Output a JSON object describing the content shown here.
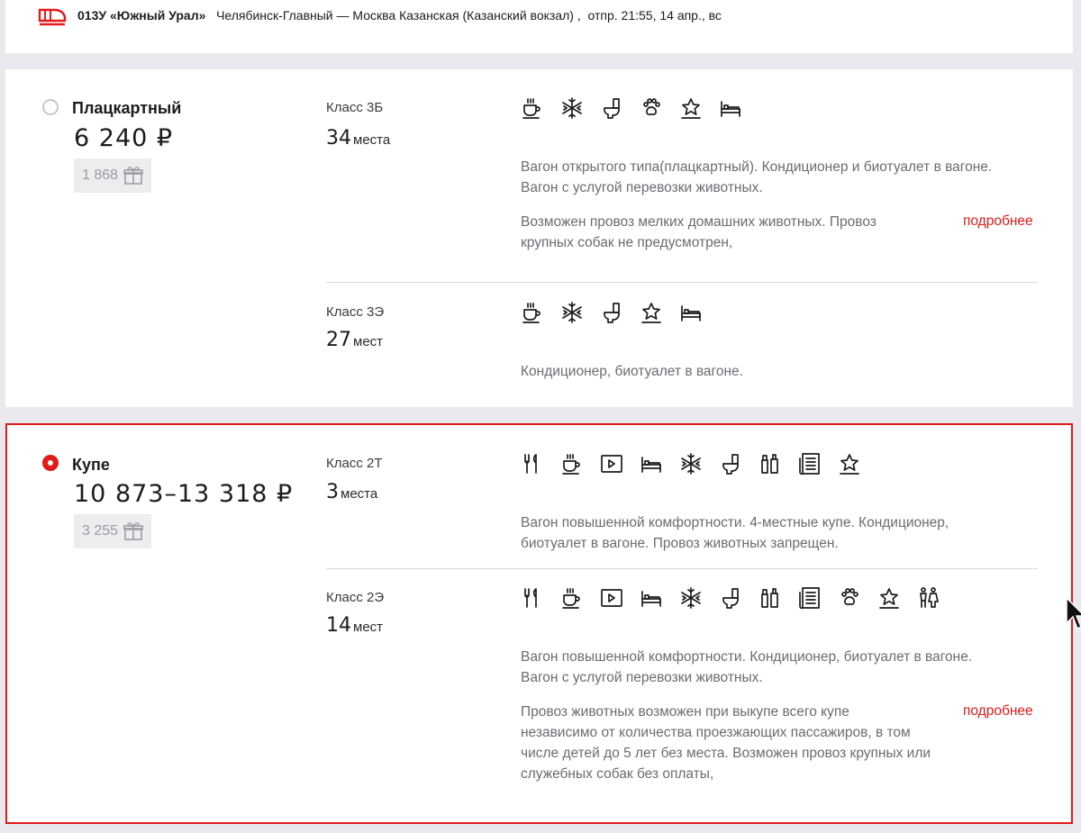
{
  "train": {
    "number_name": "013У «Южный Урал»",
    "route": "Челябинск-Главный — Москва Казанская (Казанский вокзал)",
    "departure": "отпр. 21:55, 14 апр., вс"
  },
  "platskart": {
    "name": "Плацкартный",
    "price": "6 240 ₽",
    "bonus": "1 868",
    "selected": false,
    "classes": [
      {
        "label": "Класс 3Б",
        "seats_num": "34",
        "seats_word": "места",
        "icons": [
          "coffee-icon",
          "snowflake-icon",
          "toilet-icon",
          "paw-icon",
          "star-icon",
          "bed-icon"
        ],
        "desc1": "Вагон открытого типа(плацкартный). Кондиционер и биотуалет в вагоне.",
        "desc2": "Вагон с услугой перевозки животных.",
        "pets1": "Возможен провоз мелких домашних животных. Провоз",
        "pets2": "крупных собак не предусмотрен,",
        "more": "подробнее"
      },
      {
        "label": "Класс 3Э",
        "seats_num": "27",
        "seats_word": "мест",
        "icons": [
          "coffee-icon",
          "snowflake-icon",
          "toilet-icon",
          "star-icon",
          "bed-icon"
        ],
        "desc1": "Кондиционер, биотуалет в вагоне."
      }
    ]
  },
  "kupe": {
    "name": "Купе",
    "price": "10 873–13 318 ₽",
    "bonus": "3 255",
    "selected": true,
    "classes": [
      {
        "label": "Класс 2Т",
        "seats_num": "3",
        "seats_word": "места",
        "icons": [
          "food-icon",
          "coffee-icon",
          "video-icon",
          "bed-icon",
          "snowflake-icon",
          "toilet-icon",
          "hygiene-kit-icon",
          "newspaper-icon",
          "star-icon"
        ],
        "desc1": "Вагон повышенной комфортности. 4-местные купе. Кондиционер,",
        "desc2": "биотуалет в вагоне. Провоз животных запрещен."
      },
      {
        "label": "Класс 2Э",
        "seats_num": "14",
        "seats_word": "мест",
        "icons": [
          "food-icon",
          "coffee-icon",
          "video-icon",
          "bed-icon",
          "snowflake-icon",
          "toilet-icon",
          "hygiene-kit-icon",
          "newspaper-icon",
          "paw-icon",
          "star-icon",
          "gender-icon"
        ],
        "desc1": "Вагон повышенной комфортности. Кондиционер, биотуалет в вагоне.",
        "desc2": "Вагон с услугой перевозки животных.",
        "pets1": "Провоз животных возможен при выкупе всего купе",
        "pets2": "независимо от количества проезжающих пассажиров, в том",
        "pets3": "числе детей до 5 лет без места. Возможен провоз крупных или",
        "pets4": "служебных собак без оплаты,",
        "more": "подробнее"
      }
    ]
  },
  "colors": {
    "accent": "#e21a1a",
    "muted": "#6b6b73",
    "bg": "#e9e9ee"
  }
}
